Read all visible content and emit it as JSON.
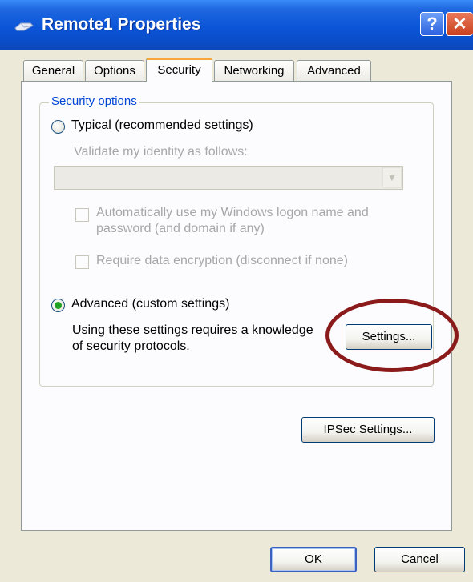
{
  "window": {
    "title": "Remote1 Properties"
  },
  "titlebar": {
    "help_icon": "question-icon",
    "close_icon": "close-icon"
  },
  "tabs": [
    {
      "label": "General"
    },
    {
      "label": "Options"
    },
    {
      "label": "Security"
    },
    {
      "label": "Networking"
    },
    {
      "label": "Advanced"
    }
  ],
  "active_tab": "Security",
  "security_options": {
    "group_label": "Security options",
    "typical_label": "Typical (recommended settings)",
    "typical_selected": false,
    "validate_label": "Validate my identity as follows:",
    "validate_value": "",
    "auto_logon_line1": "Automatically use my Windows logon name and",
    "auto_logon_line2": "password (and domain if any)",
    "require_encryption_label": "Require data encryption (disconnect if none)",
    "advanced_label": "Advanced (custom settings)",
    "advanced_selected": true,
    "advanced_desc_line1": "Using these settings requires a knowledge",
    "advanced_desc_line2": "of security protocols.",
    "settings_button": "Settings..."
  },
  "ipsec_button": "IPSec Settings...",
  "footer": {
    "ok": "OK",
    "cancel": "Cancel"
  },
  "colors": {
    "titlebar": "#0B55D8",
    "group_label": "#0046D5",
    "annotation_circle": "#8B1A1A",
    "radio_dot": "#21A121"
  }
}
